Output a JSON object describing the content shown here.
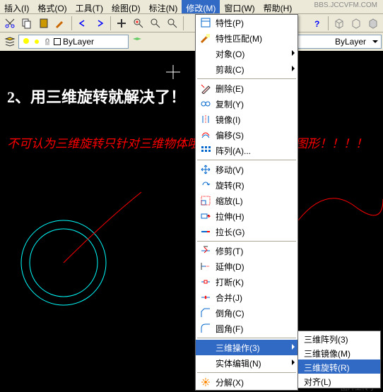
{
  "watermark": "BBS.JCCVFM.COM",
  "menubar": [
    {
      "label": "插入(I)"
    },
    {
      "label": "格式(O)"
    },
    {
      "label": "工具(T)"
    },
    {
      "label": "绘图(D)"
    },
    {
      "label": "标注(N)"
    },
    {
      "label": "修改(M)",
      "active": true
    },
    {
      "label": "窗口(W)"
    },
    {
      "label": "帮助(H)"
    }
  ],
  "layer": {
    "bylayer": "ByLayer",
    "bylayer2": "ByLayer"
  },
  "canvas_text": {
    "white": "2、用三维旋转就解决了！",
    "red": "不可认为三维旋转只针对三维物体哦，同样适用于平面图形！！！！"
  },
  "dropdown": [
    {
      "icon": "properties",
      "label": "特性(P)"
    },
    {
      "icon": "match",
      "label": "特性匹配(M)"
    },
    {
      "label": "对象(O)",
      "sub": true
    },
    {
      "label": "剪裁(C)",
      "sub": true
    },
    {
      "sep": true
    },
    {
      "icon": "erase",
      "label": "删除(E)"
    },
    {
      "icon": "copy",
      "label": "复制(Y)"
    },
    {
      "icon": "mirror",
      "label": "镜像(I)"
    },
    {
      "icon": "offset",
      "label": "偏移(S)"
    },
    {
      "icon": "array",
      "label": "阵列(A)..."
    },
    {
      "sep": true
    },
    {
      "icon": "move",
      "label": "移动(V)"
    },
    {
      "icon": "rotate",
      "label": "旋转(R)"
    },
    {
      "icon": "scale",
      "label": "缩放(L)"
    },
    {
      "icon": "stretch",
      "label": "拉伸(H)"
    },
    {
      "icon": "lengthen",
      "label": "拉长(G)"
    },
    {
      "sep": true
    },
    {
      "icon": "trim",
      "label": "修剪(T)"
    },
    {
      "icon": "extend",
      "label": "延伸(D)"
    },
    {
      "icon": "break",
      "label": "打断(K)"
    },
    {
      "icon": "join",
      "label": "合并(J)"
    },
    {
      "icon": "chamfer",
      "label": "倒角(C)"
    },
    {
      "icon": "fillet",
      "label": "圆角(F)"
    },
    {
      "sep": true
    },
    {
      "label": "三维操作(3)",
      "sub": true,
      "hover": true
    },
    {
      "label": "实体编辑(N)",
      "sub": true
    },
    {
      "sep": true
    },
    {
      "icon": "explode",
      "label": "分解(X)"
    }
  ],
  "submenu": [
    {
      "label": "三维阵列(3)"
    },
    {
      "label": "三维镜像(M)"
    },
    {
      "label": "三维旋转(R)",
      "hover": true
    },
    {
      "label": "对齐(L)"
    }
  ],
  "footer": "图片上传于"
}
